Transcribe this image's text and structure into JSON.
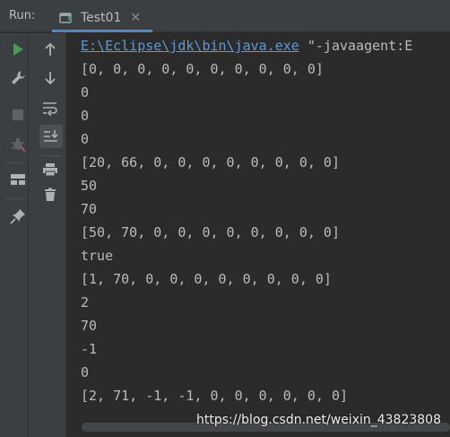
{
  "header": {
    "run_label": "Run:",
    "tab_title": "Test01",
    "tab_close": "✕"
  },
  "toolbar_left": [
    "run-icon",
    "wrench-icon",
    "stop-icon",
    "debug-icon",
    "layout-icon",
    "pin-icon"
  ],
  "toolbar_right": [
    "arrow-up-icon",
    "arrow-down-icon",
    "soft-wrap-icon",
    "scroll-to-end-icon",
    "print-icon",
    "trash-icon"
  ],
  "console": {
    "command_path": "E:\\Eclipse\\jdk\\bin\\java.exe",
    "command_args": " \"-javaagent:E",
    "lines": [
      "[0, 0, 0, 0, 0, 0, 0, 0, 0, 0]",
      "0",
      "0",
      "0",
      "[20, 66, 0, 0, 0, 0, 0, 0, 0, 0]",
      "50",
      "70",
      "[50, 70, 0, 0, 0, 0, 0, 0, 0, 0]",
      "true",
      "[1, 70, 0, 0, 0, 0, 0, 0, 0, 0]",
      "2",
      "70",
      "-1",
      "0",
      "[2, 71, -1, -1, 0, 0, 0, 0, 0, 0]"
    ]
  },
  "watermark": "https://blog.csdn.net/weixin_43823808",
  "colors": {
    "background": "#2b2b2b",
    "panel": "#3c3f41",
    "text": "#bbbbbb",
    "link": "#5a9bd5",
    "run_green": "#499c54",
    "tab_accent": "#4a88c7"
  }
}
